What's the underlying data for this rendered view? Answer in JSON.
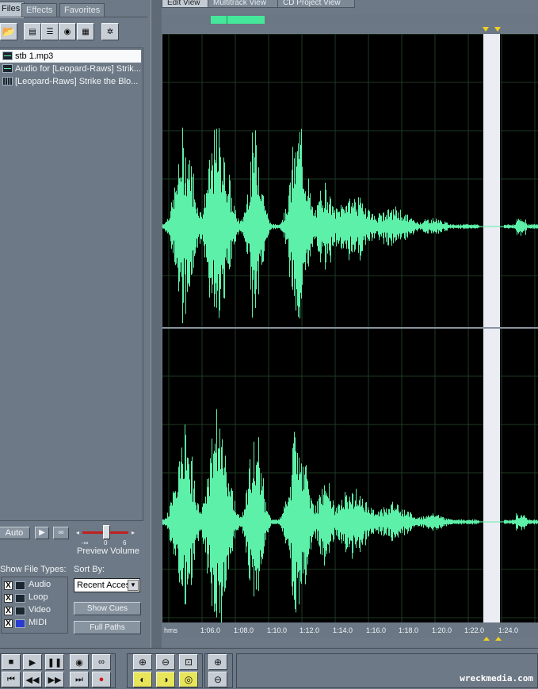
{
  "left_tabs": [
    {
      "label": "Files",
      "active": true
    },
    {
      "label": "Effects",
      "active": false
    },
    {
      "label": "Favorites",
      "active": false
    }
  ],
  "toolbar_icons": [
    "open-file-icon",
    "import-icon",
    "close-file-icon",
    "record-icon",
    "insert-multitrack-icon",
    "autoplay-icon"
  ],
  "files": [
    {
      "name": "stb 1.mp3",
      "icon": "audio-file-icon",
      "selected": true
    },
    {
      "name": "Audio for [Leopard-Raws] Strik...",
      "icon": "audio-file-icon",
      "selected": false
    },
    {
      "name": "[Leopard-Raws] Strike the Blo...",
      "icon": "video-file-icon",
      "selected": false
    }
  ],
  "preview": {
    "auto_label": "Auto",
    "play_icon": "play-icon",
    "loop_icon": "loop-icon",
    "scale_min": "-∞",
    "scale_mid": "0",
    "scale_max": "6",
    "volume_label": "Preview Volume"
  },
  "show_file_types": {
    "label": "Show File Types:",
    "items": [
      {
        "label": "Audio",
        "checked": "X"
      },
      {
        "label": "Loop",
        "checked": "X"
      },
      {
        "label": "Video",
        "checked": "X"
      },
      {
        "label": "MIDI",
        "checked": "X"
      }
    ]
  },
  "sort": {
    "label": "Sort By:",
    "value": "Recent Access",
    "show_cues": "Show Cues",
    "full_paths": "Full Paths"
  },
  "editor_tabs": [
    {
      "label": "Edit View",
      "active": true
    },
    {
      "label": "Multitrack View",
      "active": false
    },
    {
      "label": "CD Project View",
      "active": false
    }
  ],
  "time_scale": {
    "unit": "hms",
    "ticks": [
      "1:06.0",
      "1:08.0",
      "1:10.0",
      "1:12.0",
      "1:14.0",
      "1:16.0",
      "1:18.0",
      "1:20.0",
      "1:22.0",
      "1:24.0"
    ]
  },
  "transport_icons": [
    "stop-icon",
    "play-icon",
    "pause-icon",
    "play-to-end-icon",
    "loop-play-icon",
    "go-to-start-icon",
    "rewind-icon",
    "fast-forward-icon",
    "go-to-end-icon",
    "record-icon"
  ],
  "zoom_icons": [
    "zoom-in-horizontal-icon",
    "zoom-out-horizontal-icon",
    "zoom-out-full-icon",
    "zoom-in-vertical-icon",
    "zoom-to-left-icon",
    "zoom-to-right-icon",
    "zoom-selection-icon",
    "zoom-out-vertical-icon"
  ],
  "colors": {
    "waveform": "#5cf0a8",
    "background": "#000000",
    "grid": "#1e3a22",
    "selection": "#ececf4"
  },
  "watermark": "wreckmedia.com"
}
